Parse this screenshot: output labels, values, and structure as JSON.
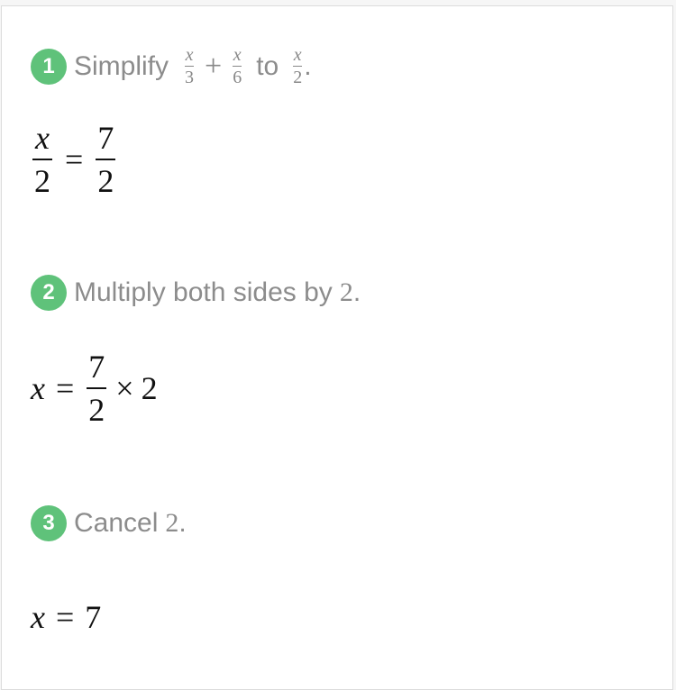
{
  "steps": [
    {
      "number": "1",
      "instruction": {
        "prefix": "Simplify",
        "expr_a": {
          "num": "x",
          "den": "3"
        },
        "operator": "+",
        "expr_b": {
          "num": "x",
          "den": "6"
        },
        "connector": "to",
        "result": {
          "num": "x",
          "den": "2"
        },
        "suffix": "."
      },
      "equation": {
        "lhs": {
          "num": "x",
          "den": "2"
        },
        "relation": "=",
        "rhs": {
          "num": "7",
          "den": "2"
        }
      }
    },
    {
      "number": "2",
      "instruction": {
        "text": "Multiply both sides by",
        "value": "2",
        "suffix": "."
      },
      "equation": {
        "lhs": "x",
        "relation": "=",
        "rhs_frac": {
          "num": "7",
          "den": "2"
        },
        "operator": "×",
        "factor": "2"
      }
    },
    {
      "number": "3",
      "instruction": {
        "text": "Cancel",
        "value": "2",
        "suffix": "."
      },
      "equation": {
        "lhs": "x",
        "relation": "=",
        "rhs": "7"
      }
    }
  ],
  "colors": {
    "badge": "#5fc27a",
    "instruction_text": "#8c8c8c",
    "equation_text": "#111111"
  }
}
